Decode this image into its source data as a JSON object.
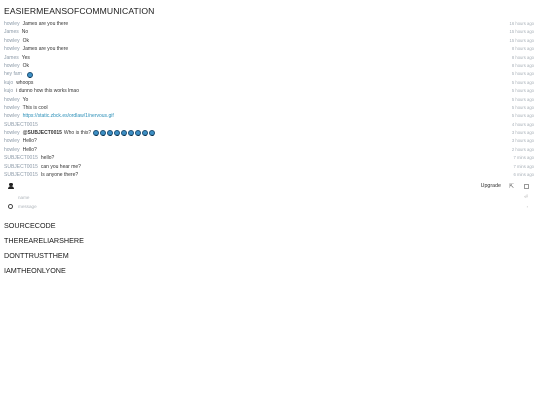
{
  "page": {
    "title": "EASIERMEANSOFCOMMUNICATION"
  },
  "messages": [
    {
      "author": "howley",
      "text": "James are you there",
      "time": "16 hours ago"
    },
    {
      "author": "James",
      "text": "No",
      "time": "15 hours ago"
    },
    {
      "author": "howley",
      "text": "Ok",
      "time": "15 hours ago"
    },
    {
      "author": "howley",
      "text": "James are you there",
      "time": "8 hours ago"
    },
    {
      "author": "James",
      "text": "Yes",
      "time": "8 hours ago"
    },
    {
      "author": "howley",
      "text": "Ok",
      "time": "8 hours ago"
    },
    {
      "author": "hey fam",
      "text": "",
      "emoji_count": 1,
      "time": "5 hours ago"
    },
    {
      "author": "kujo",
      "text": "whoops",
      "time": "5 hours ago"
    },
    {
      "author": "kujo",
      "text": "i dunno how this works lmao",
      "time": "5 hours ago"
    },
    {
      "author": "howley",
      "text": "Yo",
      "time": "5 hours ago"
    },
    {
      "author": "howley",
      "text": "This is cool",
      "time": "5 hours ago"
    },
    {
      "author": "howley",
      "text": "https://static.zbck.es/ordlaw/1/nervous.gif",
      "link": true,
      "time": "5 hours ago"
    },
    {
      "author": "SUBJECT0015",
      "text": "",
      "time": "4 hours ago"
    },
    {
      "author": "howley",
      "text": "@SUBJECT0015 Who is this?",
      "bold_prefix": "@SUBJECT0015",
      "rest": "Who is this?",
      "emoji_count": 9,
      "time": "3 hours ago"
    },
    {
      "author": "howley",
      "text": "Hello?",
      "time": "3 hours ago"
    },
    {
      "author": "howley",
      "text": "Hello?",
      "time": "2 hours ago"
    },
    {
      "author": "SUBJECT0015",
      "text": "hello?",
      "time": "7 mins ago"
    },
    {
      "author": "SUBJECT0015",
      "text": "can you hear me?",
      "time": "7 mins ago"
    },
    {
      "author": "SUBJECT0015",
      "text": "Is anyone there?",
      "time": "6 mins ago"
    }
  ],
  "toolbar": {
    "upgrade_label": "Upgrade",
    "popout_icon": "external-link-icon",
    "user_icon": "user-icon"
  },
  "compose": {
    "name_placeholder": "name",
    "message_placeholder": "message",
    "send_symbol": "⏎",
    "caret_symbol": "›"
  },
  "footer": {
    "lines": [
      "SOURCECODE",
      "THEREARELIARSHERE",
      "DONTTRUSTTHEM",
      "IAMTHEONLYONE"
    ]
  },
  "colors": {
    "author": "#8c9aa8",
    "link": "#2a8fb8",
    "emoji": "#3d8fc4"
  }
}
